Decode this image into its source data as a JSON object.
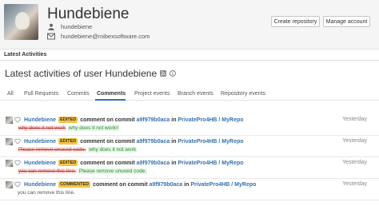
{
  "profile": {
    "name": "Hundebiene",
    "username": "hundebiene",
    "email": "hundebiene@mibexsoftware.com",
    "buttons": {
      "create_repository": "Create repository",
      "manage_account": "Manage account"
    }
  },
  "section": {
    "title": "Latest Activities"
  },
  "page": {
    "title": "Latest activities of user Hundebiene"
  },
  "tabs": [
    {
      "label": "All"
    },
    {
      "label": "Pull Requests"
    },
    {
      "label": "Commits"
    },
    {
      "label": "Comments"
    },
    {
      "label": "Project events"
    },
    {
      "label": "Branch events"
    },
    {
      "label": "Repository events"
    }
  ],
  "active_tab": "Comments",
  "activities": [
    {
      "user": "Hundebiene",
      "badge": "EDITED",
      "action": "comment on commit",
      "commit": "a9f979b0aca",
      "in": "in",
      "repo": "PrivatePro4HB / MyRepo",
      "time": "Yesterday",
      "old_text": "why does it not work",
      "new_text": "why does it not work!!"
    },
    {
      "user": "Hundebiene",
      "badge": "EDITED",
      "action": "comment on commit",
      "commit": "a9f979b0aca",
      "in": "in",
      "repo": "PrivatePro4HB / MyRepo",
      "time": "Yesterday",
      "old_text": "Please remove unused code.",
      "new_text": "why does it not work"
    },
    {
      "user": "Hundebiene",
      "badge": "EDITED",
      "action": "comment on commit",
      "commit": "a9f979b0aca",
      "in": "in",
      "repo": "PrivatePro4HB / MyRepo",
      "time": "Yesterday",
      "old_text": "you can remove this line.",
      "new_text": "Please remove unused code."
    },
    {
      "user": "Hundebiene",
      "badge": "COMMENTED",
      "action": "comment on commit",
      "commit": "a9f979b0aca",
      "in": "in",
      "repo": "PrivatePro4HB / MyRepo",
      "time": "Yesterday",
      "text": "you can remove this line."
    }
  ],
  "colors": {
    "link": "#3572b0",
    "badge": "#f6c342",
    "deleted": "#b6433c",
    "added": "#2f8a3a"
  },
  "icons": {
    "username": "user-icon",
    "email": "email-icon",
    "rss": "rss-icon",
    "info": "info-icon",
    "heart": "heart-icon"
  }
}
